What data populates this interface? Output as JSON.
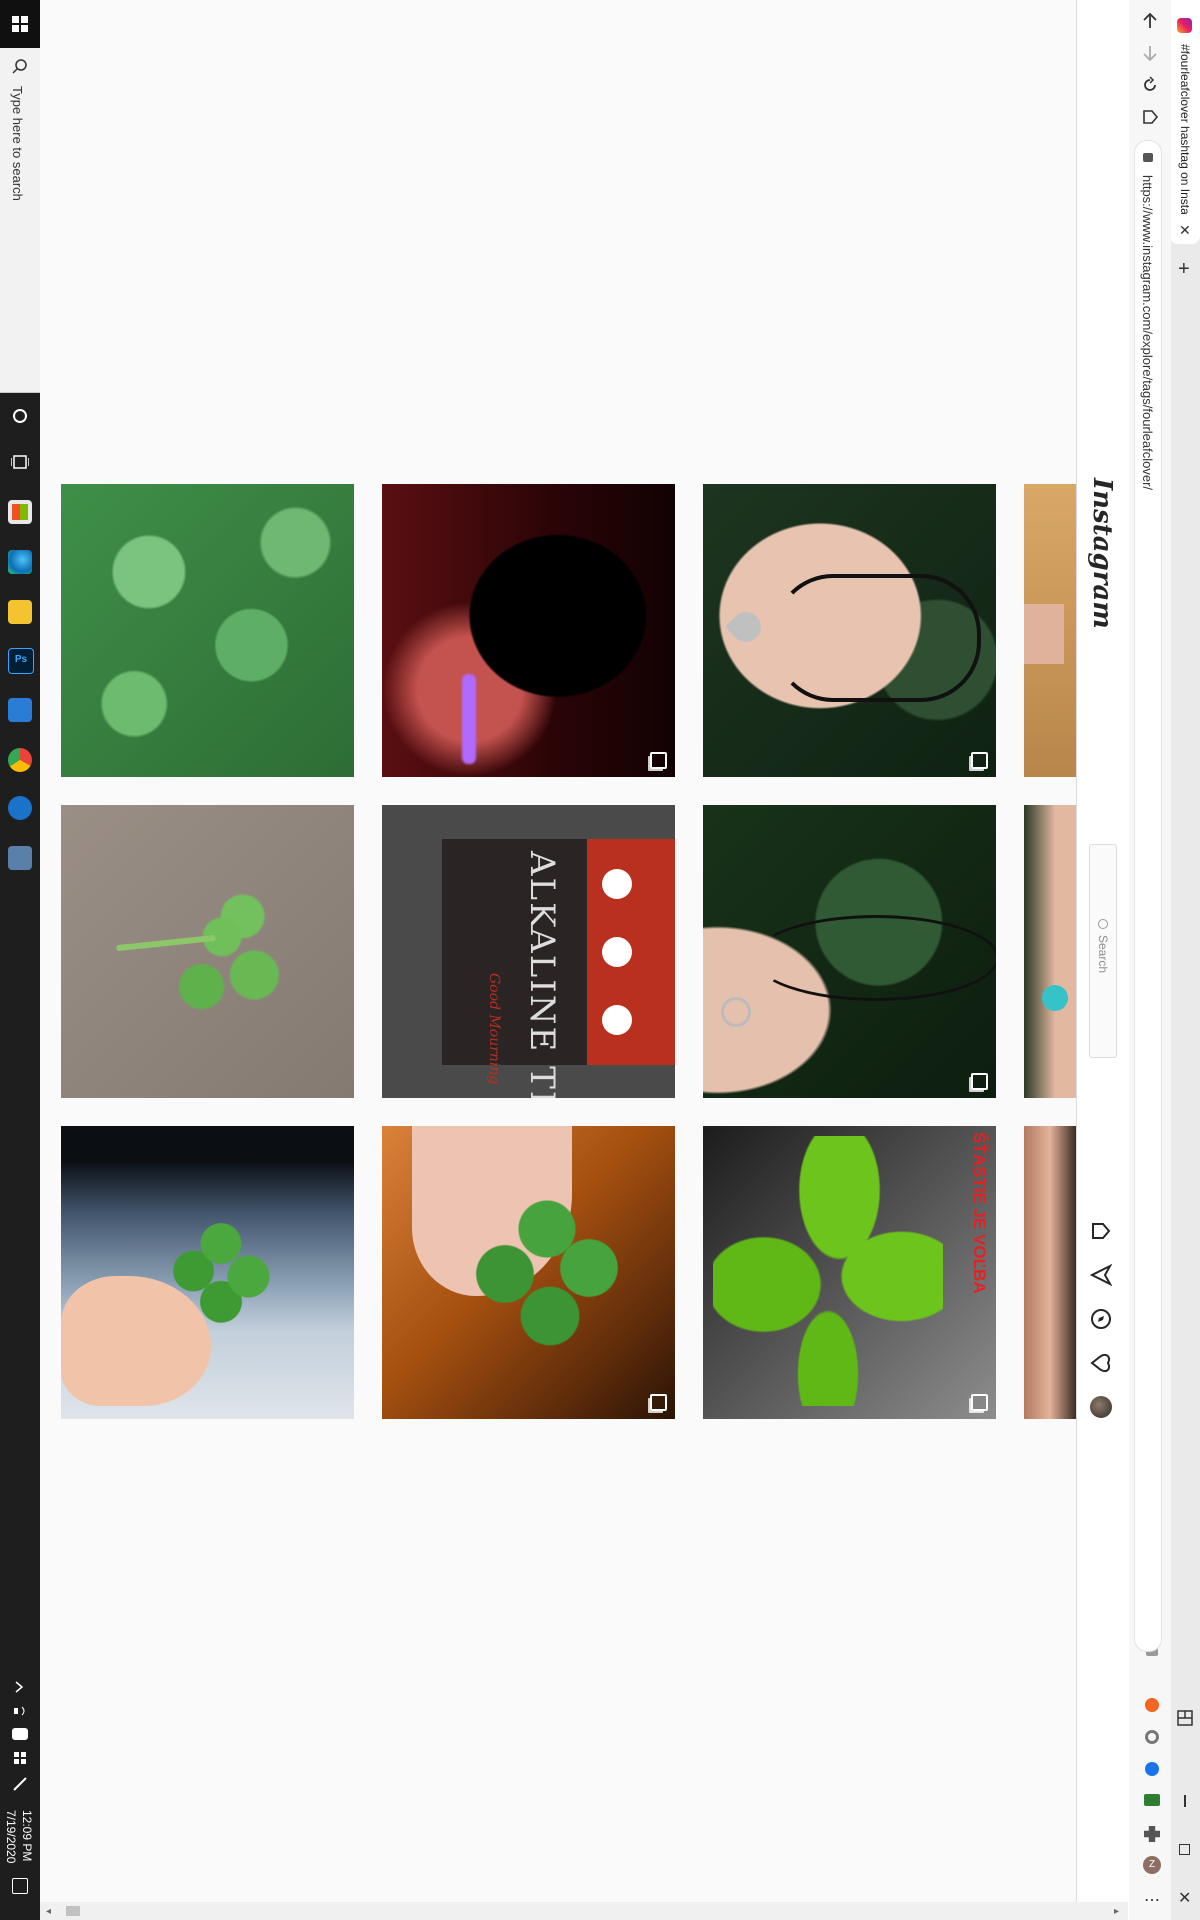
{
  "taskbar": {
    "search_placeholder": "Type here to search",
    "time": "12:09 PM",
    "date": "7/19/2020"
  },
  "browser": {
    "tab_title": "#fourleafclover hashtag on Insta...",
    "url": "https://www.instagram.com/explore/tags/fourleafclover/",
    "new_tab_label": "+"
  },
  "instagram": {
    "logo": "Instagram",
    "search_placeholder": "Search",
    "nav_icons": [
      "home-icon",
      "direct-icon",
      "explore-icon",
      "activity-heart-icon",
      "profile-avatar"
    ]
  },
  "grid": {
    "rows": [
      [
        {
          "desc": "clover patch",
          "multi": false
        },
        {
          "desc": "dark anime art",
          "multi": true
        },
        {
          "desc": "hand with clover pendant",
          "multi": true
        },
        {
          "desc": "partial tattoo arm",
          "multi": false
        }
      ],
      [
        {
          "desc": "clover on sand",
          "multi": false
        },
        {
          "desc": "album cover",
          "multi": false,
          "band": "ALKALINE TRIO",
          "subtitle": "Good Mourning"
        },
        {
          "desc": "hand with ring and necklace",
          "multi": true
        },
        {
          "desc": "partial hand with pin",
          "multi": false
        }
      ],
      [
        {
          "desc": "hand holding clover",
          "multi": false
        },
        {
          "desc": "hand holding clover on wood",
          "multi": true
        },
        {
          "desc": "clover close-up",
          "multi": true,
          "caption": "ŠŤASTIE JE VOĽBA"
        },
        {
          "desc": "partial hand",
          "multi": false
        }
      ]
    ]
  }
}
